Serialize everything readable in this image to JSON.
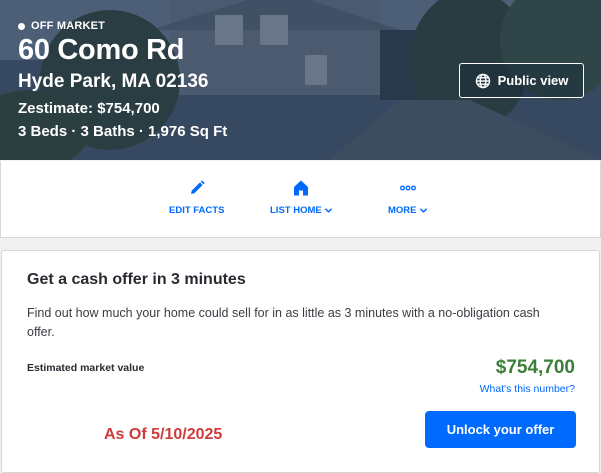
{
  "hero": {
    "status": "OFF MARKET",
    "address_line1": "60 Como Rd",
    "address_line2": "Hyde Park, MA 02136",
    "zestimate": "Zestimate: $754,700",
    "facts": "3 Beds · 3 Baths · 1,976 Sq Ft",
    "public_view_label": "Public view"
  },
  "actions": [
    {
      "label": "EDIT FACTS",
      "icon": "pencil-icon"
    },
    {
      "label": "LIST HOME",
      "icon": "house-icon",
      "has_dropdown": true
    },
    {
      "label": "MORE",
      "icon": "more-dots-icon",
      "has_dropdown": true
    }
  ],
  "cash_offer": {
    "title": "Get a cash offer in 3 minutes",
    "description": "Find out how much your home could sell for in as little as 3 minutes with a no-obligation cash offer.",
    "estimated_label": "Estimated market value",
    "estimated_value": "$754,700",
    "whats_this": "What's this number?",
    "as_of": "As Of 5/10/2025",
    "unlock_label": "Unlock your offer"
  },
  "colors": {
    "accent": "#006aff",
    "value_green": "#3a7f3a",
    "as_of_red": "#cf3a3a",
    "hero_overlay": "#2b3e54"
  }
}
